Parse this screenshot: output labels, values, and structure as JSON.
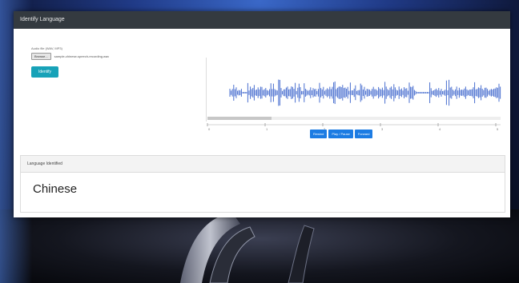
{
  "app": {
    "title": "Identify Language"
  },
  "upload": {
    "label": "Audio file (WAV, MP3)",
    "browse_label": "Browse...",
    "file_name": "sample-chinese-speech-recording.wav"
  },
  "identify_button": "Identify",
  "waveform": {
    "color": "#4a6fd0",
    "timeline_ticks": [
      "0",
      "1",
      "2",
      "3",
      "4",
      "5"
    ]
  },
  "player": {
    "buttons": [
      "Rewind",
      "Play / Pause",
      "Forward"
    ]
  },
  "result": {
    "header": "Language Identified",
    "language": "Chinese"
  }
}
